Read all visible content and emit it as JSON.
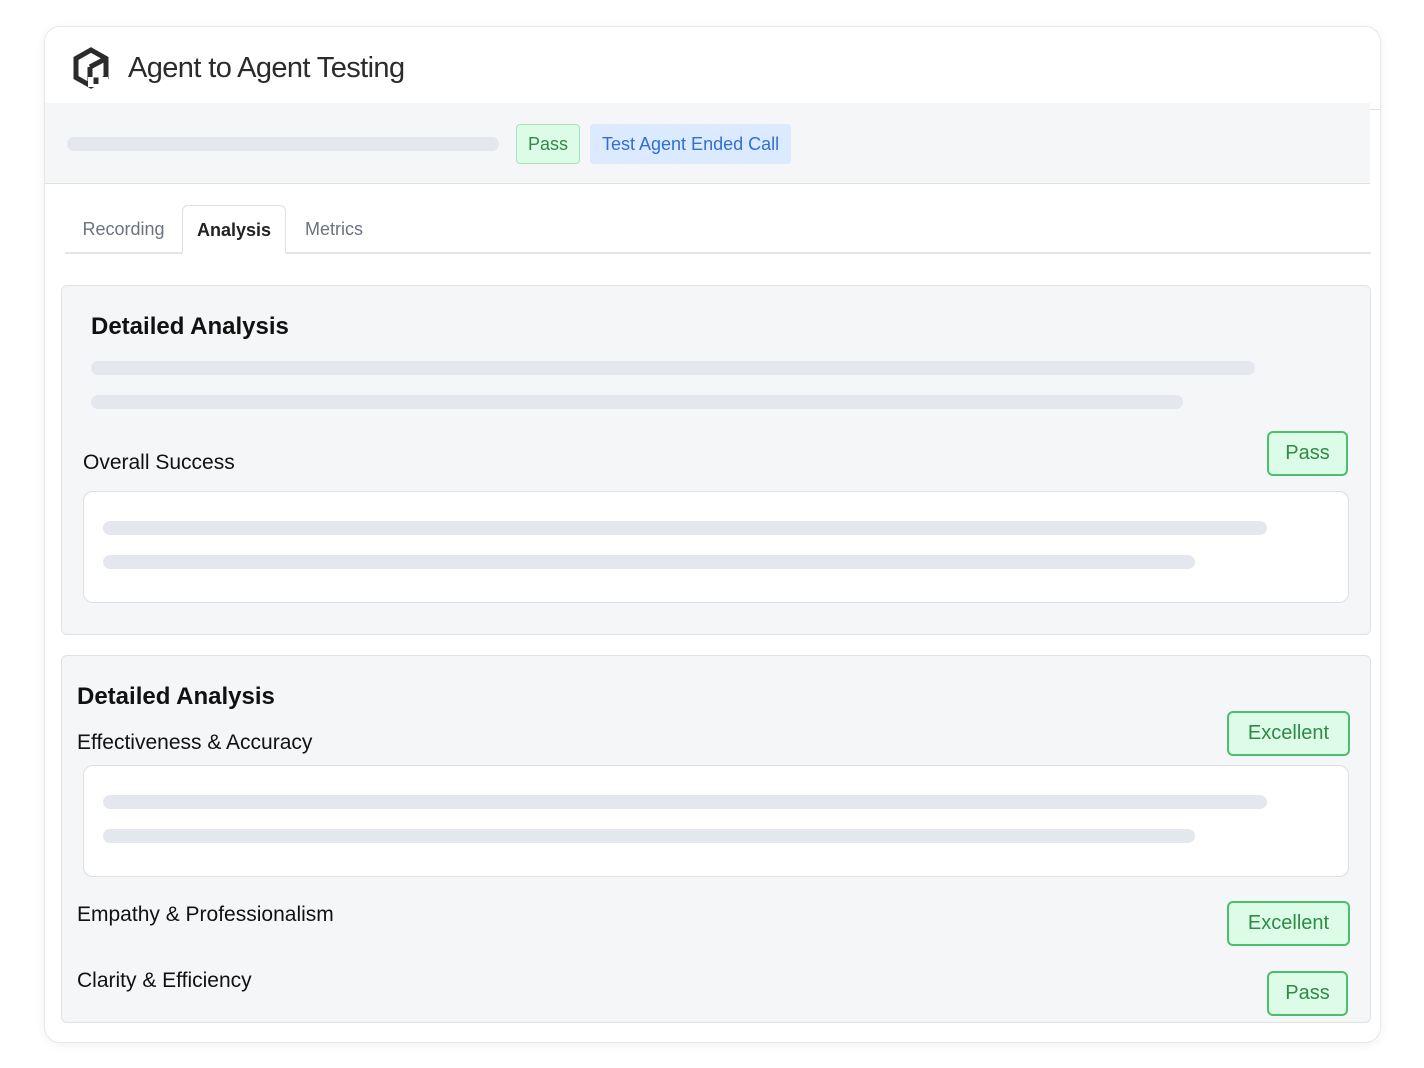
{
  "app": {
    "title": "Agent to Agent Testing",
    "logo_icon": "hexagon-logo-icon"
  },
  "status_bar": {
    "pass_badge": "Pass",
    "reason_badge": "Test Agent Ended Call"
  },
  "tabs": [
    {
      "label": "Recording",
      "active": false
    },
    {
      "label": "Analysis",
      "active": true
    },
    {
      "label": "Metrics",
      "active": false
    }
  ],
  "section1": {
    "title": "Detailed Analysis",
    "overall": {
      "label": "Overall Success",
      "badge": "Pass"
    }
  },
  "section2": {
    "title": "Detailed Analysis",
    "metrics": [
      {
        "label": "Effectiveness & Accuracy",
        "badge": "Excellent"
      },
      {
        "label": "Empathy & Professionalism",
        "badge": "Excellent"
      },
      {
        "label": "Clarity & Efficiency",
        "badge": "Pass"
      }
    ]
  },
  "colors": {
    "pass_green": "#2f8a45",
    "pass_bg": "#dcfce7",
    "info_blue": "#2f6fd6",
    "info_bg": "#dbeafe",
    "skeleton": "#e4e8ee",
    "panel_bg": "#f5f6f8"
  }
}
